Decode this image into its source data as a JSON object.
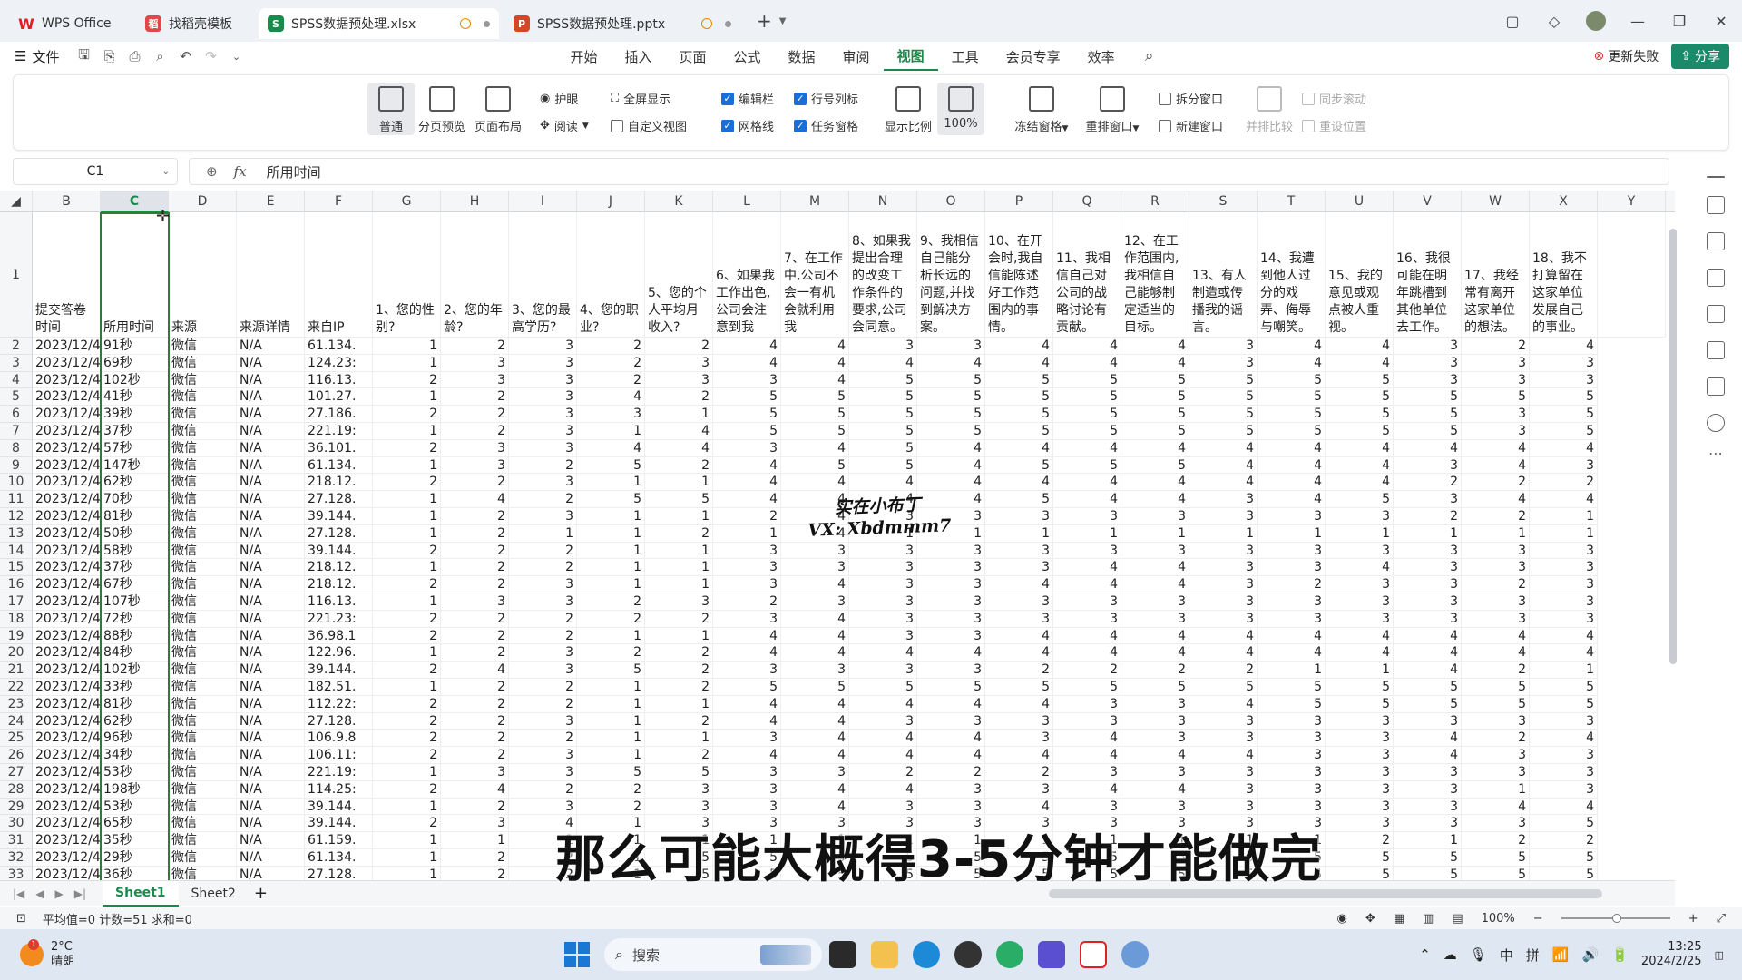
{
  "titlebar": {
    "tabs": [
      {
        "label": "WPS Office",
        "icon": "wps-logo",
        "color": "#e02020"
      },
      {
        "label": "找稻壳模板",
        "icon": "docer-icon",
        "color": "#e04848"
      },
      {
        "label": "SPSS数据预处理.xlsx",
        "icon": "xlsx-icon",
        "color": "#1a8a4a"
      },
      {
        "label": "SPSS数据预处理.pptx",
        "icon": "pptx-icon",
        "color": "#d24726"
      }
    ],
    "new_tab": "+"
  },
  "menubar": {
    "file": "文件",
    "items": [
      "开始",
      "插入",
      "页面",
      "公式",
      "数据",
      "审阅",
      "视图",
      "工具",
      "会员专享",
      "效率"
    ],
    "active": "视图",
    "update_fail": "更新失败",
    "share": "分享"
  },
  "ribbon": {
    "normal": "普通",
    "page_break": "分页预览",
    "page_layout": "页面布局",
    "eye_care": "护眼",
    "reading": "阅读",
    "fullscreen": "全屏显示",
    "custom_view": "自定义视图",
    "formula_bar": "编辑栏",
    "row_col": "行号列标",
    "gridlines": "网格线",
    "task_pane": "任务窗格",
    "zoom": "显示比例",
    "zoom100": "100%",
    "freeze": "冻结窗格",
    "rearrange": "重排窗口",
    "split": "拆分窗口",
    "new_window": "新建窗口",
    "side_by_side": "并排比较",
    "sync_scroll": "同步滚动",
    "reset_pos": "重设位置"
  },
  "formula": {
    "cell_ref": "C1",
    "fx": "fx",
    "content": "所用时间"
  },
  "columns": [
    "B",
    "C",
    "D",
    "E",
    "F",
    "G",
    "H",
    "I",
    "J",
    "K",
    "L",
    "M",
    "N",
    "O",
    "P",
    "Q",
    "R",
    "S",
    "T",
    "U",
    "V",
    "W",
    "X",
    "Y"
  ],
  "header_row": [
    "提交答卷时间",
    "所用时间",
    "来源",
    "来源详情",
    "来自IP",
    "1、您的性别?",
    "2、您的年龄?",
    "3、您的最高学历?",
    "4、您的职业?",
    "5、您的个人平均月收入?",
    "6、如果我工作出色,公司会注意到我",
    "7、在工作中,公司不会一有机会就利用我",
    "8、如果我提出合理的改变工作条件的要求,公司会同意。",
    "9、我相信自己能分析长远的问题,并找到解决方案。",
    "10、在开会时,我自信能陈述好工作范围内的事情。",
    "11、我相信自己对公司的战略讨论有贡献。",
    "12、在工作范围内,我相信自己能够制定适当的目标。",
    "13、有人制造或传播我的谣言。",
    "14、我遭到他人过分的戏弄、侮辱与嘲笑。",
    "15、我的意见或观点被人重视。",
    "16、我很可能在明年跳槽到其他单位去工作。",
    "17、我经常有离开这家单位的想法。",
    "18、我不打算留在这家单位发展自己的事业。",
    ""
  ],
  "rows": [
    [
      "2023/12/4",
      "91秒",
      "微信",
      "N/A",
      "61.134.",
      "1",
      "2",
      "3",
      "2",
      "2",
      "4",
      "4",
      "3",
      "3",
      "4",
      "4",
      "4",
      "3",
      "4",
      "4",
      "3",
      "2",
      "4"
    ],
    [
      "2023/12/4",
      "69秒",
      "微信",
      "N/A",
      "124.23:",
      "1",
      "3",
      "3",
      "2",
      "3",
      "4",
      "4",
      "4",
      "4",
      "4",
      "4",
      "4",
      "3",
      "4",
      "4",
      "3",
      "3",
      "3"
    ],
    [
      "2023/12/4",
      "102秒",
      "微信",
      "N/A",
      "116.13.",
      "2",
      "3",
      "3",
      "2",
      "3",
      "3",
      "4",
      "5",
      "5",
      "5",
      "5",
      "5",
      "5",
      "5",
      "5",
      "3",
      "3",
      "3"
    ],
    [
      "2023/12/4",
      "41秒",
      "微信",
      "N/A",
      "101.27.",
      "1",
      "2",
      "3",
      "4",
      "2",
      "5",
      "5",
      "5",
      "5",
      "5",
      "5",
      "5",
      "5",
      "5",
      "5",
      "5",
      "5",
      "5"
    ],
    [
      "2023/12/4",
      "39秒",
      "微信",
      "N/A",
      "27.186.",
      "2",
      "2",
      "3",
      "3",
      "1",
      "5",
      "5",
      "5",
      "5",
      "5",
      "5",
      "5",
      "5",
      "5",
      "5",
      "5",
      "3",
      "5"
    ],
    [
      "2023/12/4",
      "37秒",
      "微信",
      "N/A",
      "221.19:",
      "1",
      "2",
      "3",
      "1",
      "4",
      "5",
      "5",
      "5",
      "5",
      "5",
      "5",
      "5",
      "5",
      "5",
      "5",
      "5",
      "3",
      "5"
    ],
    [
      "2023/12/4",
      "57秒",
      "微信",
      "N/A",
      "36.101.",
      "2",
      "3",
      "3",
      "4",
      "4",
      "3",
      "4",
      "5",
      "4",
      "4",
      "4",
      "4",
      "4",
      "4",
      "4",
      "4",
      "4",
      "4"
    ],
    [
      "2023/12/4",
      "147秒",
      "微信",
      "N/A",
      "61.134.",
      "1",
      "3",
      "2",
      "5",
      "2",
      "4",
      "5",
      "5",
      "4",
      "5",
      "5",
      "5",
      "4",
      "4",
      "4",
      "3",
      "4",
      "3"
    ],
    [
      "2023/12/4",
      "62秒",
      "微信",
      "N/A",
      "218.12.",
      "2",
      "2",
      "3",
      "1",
      "1",
      "4",
      "4",
      "4",
      "4",
      "4",
      "4",
      "4",
      "4",
      "4",
      "4",
      "2",
      "2",
      "2"
    ],
    [
      "2023/12/4",
      "70秒",
      "微信",
      "N/A",
      "27.128.",
      "1",
      "4",
      "2",
      "5",
      "5",
      "4",
      "4",
      "4",
      "4",
      "5",
      "4",
      "4",
      "3",
      "4",
      "5",
      "3",
      "4",
      "4"
    ],
    [
      "2023/12/4",
      "81秒",
      "微信",
      "N/A",
      "39.144.",
      "1",
      "2",
      "3",
      "1",
      "1",
      "2",
      "4",
      "3",
      "3",
      "3",
      "3",
      "3",
      "3",
      "3",
      "3",
      "2",
      "2",
      "1"
    ],
    [
      "2023/12/4",
      "50秒",
      "微信",
      "N/A",
      "27.128.",
      "1",
      "2",
      "1",
      "1",
      "2",
      "1",
      "4",
      "1",
      "1",
      "1",
      "1",
      "1",
      "1",
      "1",
      "1",
      "1",
      "1",
      "1"
    ],
    [
      "2023/12/4",
      "58秒",
      "微信",
      "N/A",
      "39.144.",
      "2",
      "2",
      "2",
      "1",
      "1",
      "3",
      "3",
      "3",
      "3",
      "3",
      "3",
      "3",
      "3",
      "3",
      "3",
      "3",
      "3",
      "3"
    ],
    [
      "2023/12/4",
      "37秒",
      "微信",
      "N/A",
      "218.12.",
      "1",
      "2",
      "2",
      "1",
      "1",
      "3",
      "3",
      "3",
      "3",
      "3",
      "4",
      "4",
      "3",
      "3",
      "4",
      "3",
      "3",
      "3"
    ],
    [
      "2023/12/4",
      "67秒",
      "微信",
      "N/A",
      "218.12.",
      "2",
      "2",
      "3",
      "1",
      "1",
      "3",
      "4",
      "3",
      "3",
      "4",
      "4",
      "4",
      "3",
      "2",
      "3",
      "3",
      "2",
      "3"
    ],
    [
      "2023/12/4",
      "107秒",
      "微信",
      "N/A",
      "116.13.",
      "1",
      "3",
      "3",
      "2",
      "3",
      "2",
      "3",
      "3",
      "3",
      "3",
      "3",
      "3",
      "3",
      "3",
      "3",
      "3",
      "3",
      "3"
    ],
    [
      "2023/12/4",
      "72秒",
      "微信",
      "N/A",
      "221.23:",
      "2",
      "2",
      "2",
      "2",
      "2",
      "3",
      "4",
      "3",
      "3",
      "3",
      "3",
      "3",
      "3",
      "3",
      "3",
      "3",
      "3",
      "3"
    ],
    [
      "2023/12/4",
      "88秒",
      "微信",
      "N/A",
      "36.98.1",
      "2",
      "2",
      "2",
      "1",
      "1",
      "4",
      "4",
      "3",
      "3",
      "4",
      "4",
      "4",
      "4",
      "4",
      "4",
      "4",
      "4",
      "4"
    ],
    [
      "2023/12/4",
      "84秒",
      "微信",
      "N/A",
      "122.96.",
      "1",
      "2",
      "3",
      "2",
      "2",
      "4",
      "4",
      "4",
      "4",
      "4",
      "4",
      "4",
      "4",
      "4",
      "4",
      "4",
      "4",
      "4"
    ],
    [
      "2023/12/4",
      "102秒",
      "微信",
      "N/A",
      "39.144.",
      "2",
      "4",
      "3",
      "5",
      "2",
      "3",
      "3",
      "3",
      "3",
      "2",
      "2",
      "2",
      "2",
      "1",
      "1",
      "4",
      "2",
      "1"
    ],
    [
      "2023/12/4",
      "33秒",
      "微信",
      "N/A",
      "182.51.",
      "1",
      "2",
      "2",
      "1",
      "2",
      "5",
      "5",
      "5",
      "5",
      "5",
      "5",
      "5",
      "5",
      "5",
      "5",
      "5",
      "5",
      "5"
    ],
    [
      "2023/12/4",
      "81秒",
      "微信",
      "N/A",
      "112.22:",
      "2",
      "2",
      "2",
      "1",
      "1",
      "4",
      "4",
      "4",
      "4",
      "4",
      "3",
      "3",
      "4",
      "5",
      "5",
      "5",
      "5",
      "5"
    ],
    [
      "2023/12/4",
      "62秒",
      "微信",
      "N/A",
      "27.128.",
      "2",
      "2",
      "3",
      "1",
      "2",
      "4",
      "4",
      "3",
      "3",
      "3",
      "3",
      "3",
      "3",
      "3",
      "3",
      "3",
      "3",
      "3"
    ],
    [
      "2023/12/4",
      "96秒",
      "微信",
      "N/A",
      "106.9.8",
      "2",
      "2",
      "2",
      "1",
      "1",
      "3",
      "4",
      "4",
      "4",
      "3",
      "4",
      "3",
      "3",
      "3",
      "3",
      "4",
      "2",
      "4"
    ],
    [
      "2023/12/4",
      "34秒",
      "微信",
      "N/A",
      "106.11:",
      "2",
      "2",
      "3",
      "1",
      "2",
      "4",
      "4",
      "4",
      "4",
      "4",
      "4",
      "4",
      "4",
      "3",
      "3",
      "4",
      "3",
      "3"
    ],
    [
      "2023/12/4",
      "53秒",
      "微信",
      "N/A",
      "221.19:",
      "1",
      "3",
      "3",
      "5",
      "5",
      "3",
      "3",
      "2",
      "2",
      "2",
      "3",
      "3",
      "3",
      "3",
      "3",
      "3",
      "3",
      "3"
    ],
    [
      "2023/12/4",
      "198秒",
      "微信",
      "N/A",
      "114.25:",
      "2",
      "4",
      "2",
      "2",
      "3",
      "3",
      "4",
      "4",
      "3",
      "3",
      "4",
      "4",
      "3",
      "3",
      "3",
      "3",
      "1",
      "3"
    ],
    [
      "2023/12/4",
      "53秒",
      "微信",
      "N/A",
      "39.144.",
      "1",
      "2",
      "3",
      "2",
      "3",
      "3",
      "4",
      "3",
      "3",
      "4",
      "3",
      "3",
      "3",
      "3",
      "3",
      "3",
      "4",
      "4"
    ],
    [
      "2023/12/4",
      "65秒",
      "微信",
      "N/A",
      "39.144.",
      "2",
      "3",
      "4",
      "1",
      "3",
      "3",
      "3",
      "3",
      "3",
      "3",
      "3",
      "3",
      "3",
      "3",
      "3",
      "3",
      "3",
      "5"
    ],
    [
      "2023/12/4",
      "35秒",
      "微信",
      "N/A",
      "61.159.",
      "1",
      "1",
      "1",
      "1",
      "1",
      "1",
      "1",
      "1",
      "1",
      "1",
      "1",
      "1",
      "1",
      "1",
      "2",
      "1",
      "2",
      "2"
    ],
    [
      "2023/12/4",
      "29秒",
      "微信",
      "N/A",
      "61.134.",
      "1",
      "2",
      "2",
      "1",
      "5",
      "5",
      "5",
      "5",
      "5",
      "5",
      "5",
      "5",
      "5",
      "5",
      "5",
      "5",
      "5",
      "5"
    ],
    [
      "2023/12/4",
      "36秒",
      "微信",
      "N/A",
      "27.128.",
      "1",
      "2",
      "2",
      "1",
      "5",
      "5",
      "5",
      "5",
      "5",
      "5",
      "5",
      "5",
      "5",
      "5",
      "5",
      "5",
      "5",
      "5"
    ]
  ],
  "sheets": [
    "Sheet1",
    "Sheet2"
  ],
  "active_sheet": "Sheet1",
  "status": {
    "summary": "平均值=0  计数=51  求和=0",
    "zoom": "100%"
  },
  "watermark": {
    "line1": "实在小布丁",
    "line2": "VX: Xbdmmm7"
  },
  "subtitle": "那么可能大概得3-5分钟才能做完",
  "taskbar": {
    "temp": "2°C",
    "weather": "晴朗",
    "search": "搜索",
    "ime_cn": "中",
    "ime_pinyin": "拼",
    "time": "13:25",
    "date": "2024/2/25"
  }
}
